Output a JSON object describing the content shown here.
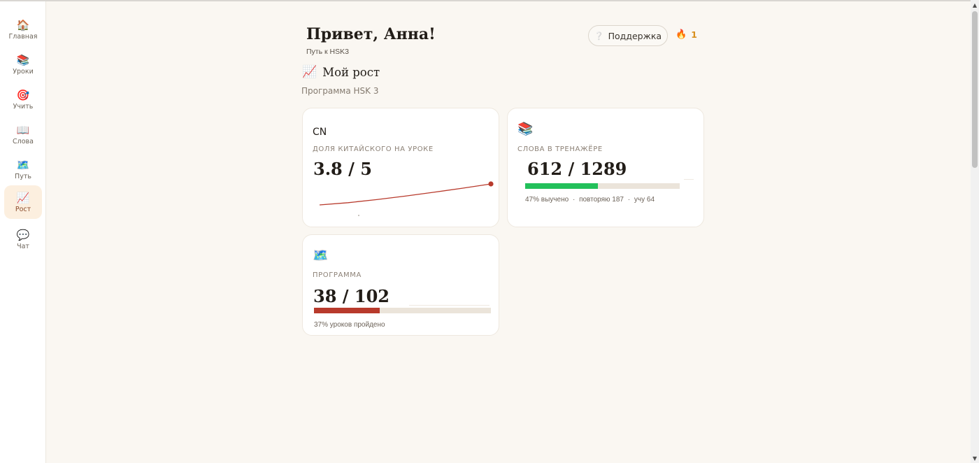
{
  "sidebar": {
    "items": [
      {
        "icon": "🏠",
        "icon_name": "home-icon",
        "label": "Главная",
        "active": false
      },
      {
        "icon": "📚",
        "icon_name": "books-icon",
        "label": "Уроки",
        "active": false
      },
      {
        "icon": "🎯",
        "icon_name": "target-icon",
        "label": "Учить",
        "active": false
      },
      {
        "icon": "📖",
        "icon_name": "open-book-icon",
        "label": "Слова",
        "active": false
      },
      {
        "icon": "🗺️",
        "icon_name": "map-icon",
        "label": "Путь",
        "active": false
      },
      {
        "icon": "📈",
        "icon_name": "chart-increasing-icon",
        "label": "Рост",
        "active": true
      },
      {
        "icon": "💬",
        "icon_name": "speech-bubble-icon",
        "label": "Чат",
        "active": false
      }
    ]
  },
  "header": {
    "greeting": "Привет, Анна!",
    "subtitle": "Путь к HSK3",
    "support_icon": "❔",
    "support_label": "Поддержка",
    "streak_icon": "🔥",
    "streak_count": "1"
  },
  "section": {
    "icon": "📈",
    "title": "Мой рост",
    "program": "Программа HSK 3"
  },
  "cards": {
    "chinese_share": {
      "badge": "CN",
      "label": "ДОЛЯ КИТАЙСКОГО НА УРОКЕ",
      "value": "3.8 / 5",
      "trend": [
        3.2,
        3.3,
        3.4,
        3.5,
        3.6,
        3.7,
        3.8
      ],
      "trend_max": 5
    },
    "trainer_words": {
      "icon": "📚",
      "label": "СЛОВА В ТРЕНАЖЁРЕ",
      "value": "612 / 1289",
      "progress": 0.47,
      "note_learned": "47% выучено",
      "note_review": "повторяю 187",
      "note_learning": "учу 64",
      "separator": "·"
    },
    "program": {
      "icon": "🗺️",
      "label": "ПРОГРАММА",
      "value": "38 / 102",
      "progress": 0.37,
      "note": "37% уроков пройдено"
    }
  },
  "colors": {
    "accent_red": "#b83a2c",
    "green": "#22c05a",
    "track": "#ebe4da",
    "background": "#faf7f2",
    "active_nav": "#fcefdf"
  }
}
